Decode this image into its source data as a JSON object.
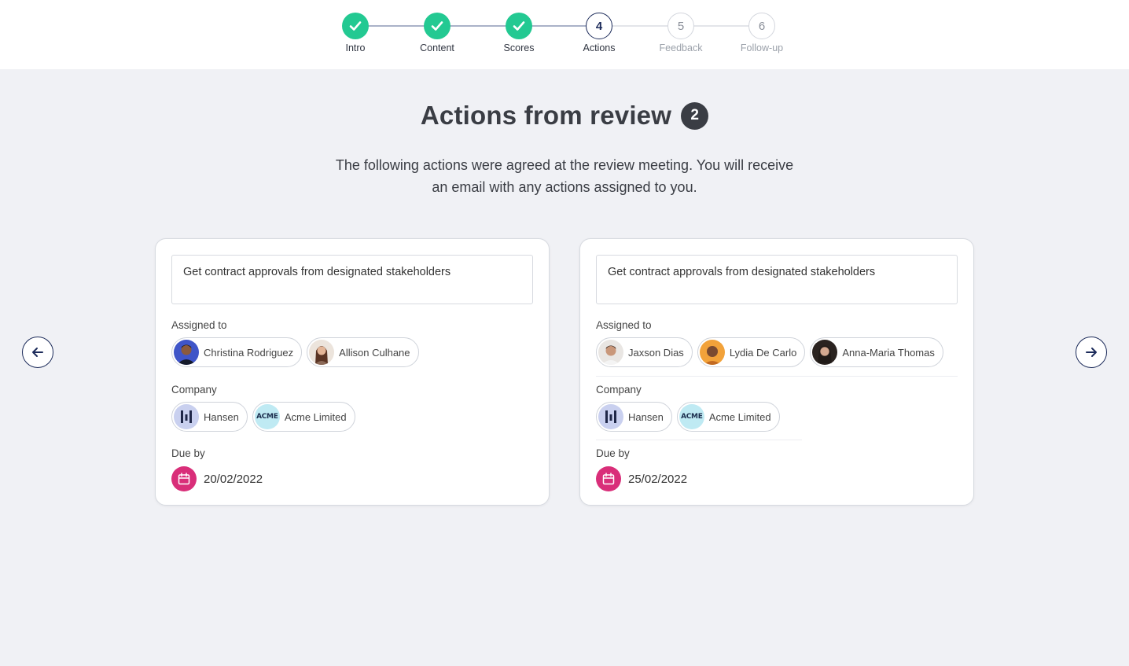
{
  "stepper": {
    "steps": [
      {
        "number": "1",
        "label": "Intro",
        "status": "done"
      },
      {
        "number": "2",
        "label": "Content",
        "status": "done"
      },
      {
        "number": "3",
        "label": "Scores",
        "status": "done"
      },
      {
        "number": "4",
        "label": "Actions",
        "status": "current"
      },
      {
        "number": "5",
        "label": "Feedback",
        "status": "todo"
      },
      {
        "number": "6",
        "label": "Follow-up",
        "status": "todo"
      }
    ]
  },
  "header": {
    "title": "Actions from review",
    "count": "2",
    "subtitle_line1": "The following actions were agreed at the review meeting. You will receive",
    "subtitle_line2": "an email with any actions assigned to you."
  },
  "labels": {
    "assigned_to": "Assigned to",
    "company": "Company",
    "due_by": "Due by"
  },
  "actions": [
    {
      "description": "Get contract approvals from designated stakeholders",
      "assignees": [
        "Christina Rodriguez",
        "Allison Culhane"
      ],
      "companies": [
        {
          "name": "Hansen",
          "logo": "hansen-logo"
        },
        {
          "name": "Acme Limited",
          "logo": "acme-logo",
          "logo_text": "ACME"
        }
      ],
      "due_date": "20/02/2022"
    },
    {
      "description": "Get contract approvals from designated stakeholders",
      "assignees": [
        "Jaxson Dias",
        "Lydia De Carlo",
        "Anna-Maria Thomas"
      ],
      "companies": [
        {
          "name": "Hansen",
          "logo": "hansen-logo"
        },
        {
          "name": "Acme Limited",
          "logo": "acme-logo",
          "logo_text": "ACME"
        }
      ],
      "due_date": "25/02/2022"
    }
  ],
  "colors": {
    "done": "#23c992",
    "current": "#1c2b5a",
    "calendar": "#d92e79",
    "hansen_bg": "#c9d0ef",
    "acme_bg": "#bfeaf3",
    "background": "#f0f1f5"
  },
  "icons": {
    "prev": "arrow-left-icon",
    "next": "arrow-right-icon",
    "done": "check-icon",
    "due": "calendar-icon"
  }
}
